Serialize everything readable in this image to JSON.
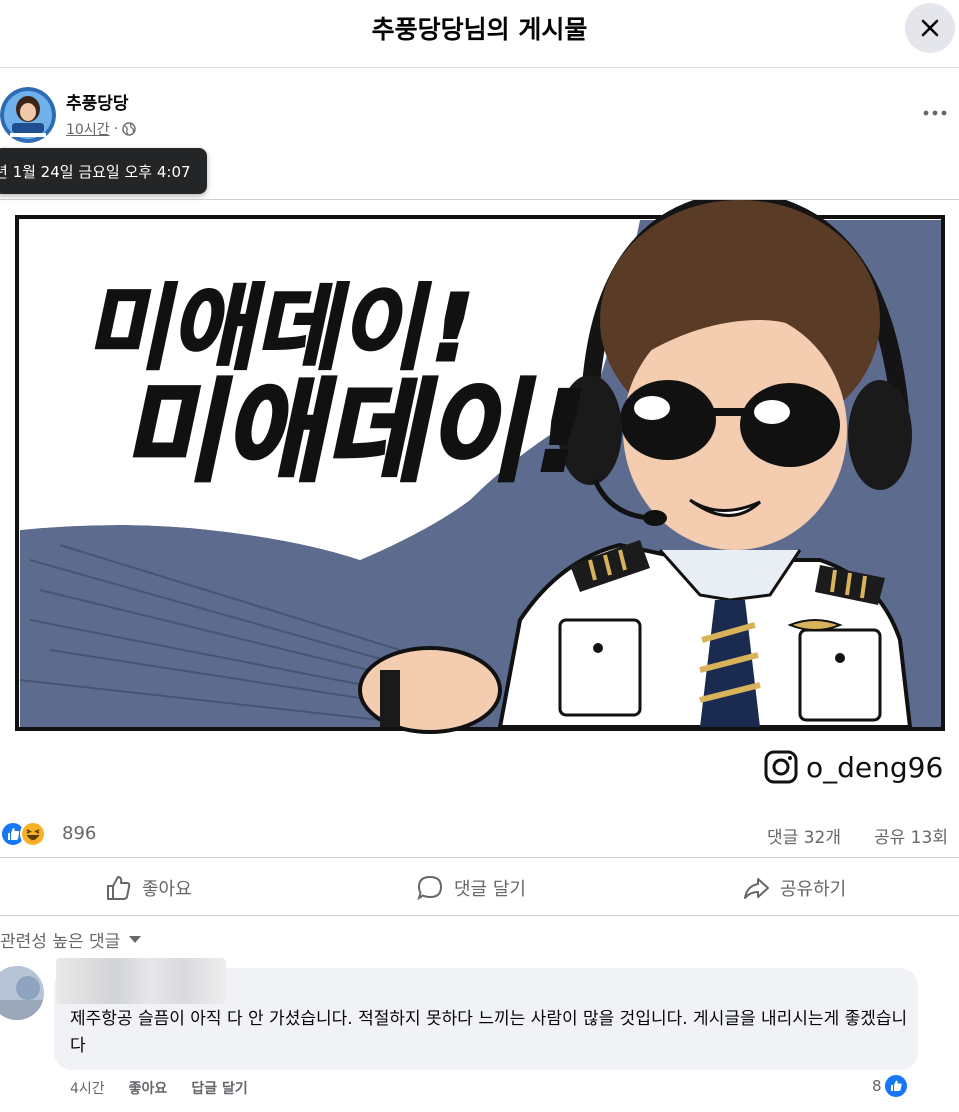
{
  "modal": {
    "title": "추풍당당님의 게시물"
  },
  "post": {
    "author": "추풍당당",
    "time": "10시간",
    "separator": "·",
    "tooltip": "년 1월 24일 금요일 오후 4:07",
    "image": {
      "caption_line1": "미애데이!",
      "caption_line2": "미애데이!",
      "instagram_handle": "o_deng96"
    },
    "reactions": {
      "count": "896",
      "types": [
        "like-icon",
        "haha-icon"
      ]
    },
    "comment_count": "댓글 32개",
    "share_count": "공유 13회"
  },
  "actions": {
    "like": "좋아요",
    "comment": "댓글 달기",
    "share": "공유하기"
  },
  "comments_section": {
    "sort_label": "관련성 높은 댓글",
    "comments": [
      {
        "text": "제주항공 슬픔이 아직 다 안 가셨습니다. 적절하지 못하다 느끼는 사람이 많을 것입니다. 게시글을 내리시는게 좋겠습니다",
        "time": "4시간",
        "like_label": "좋아요",
        "reply_label": "답글 달기",
        "like_count": "8"
      }
    ]
  },
  "colors": {
    "facebook_blue": "#1877f2",
    "text_secondary": "#65676b",
    "comic_slate": "#5d6b8e"
  }
}
